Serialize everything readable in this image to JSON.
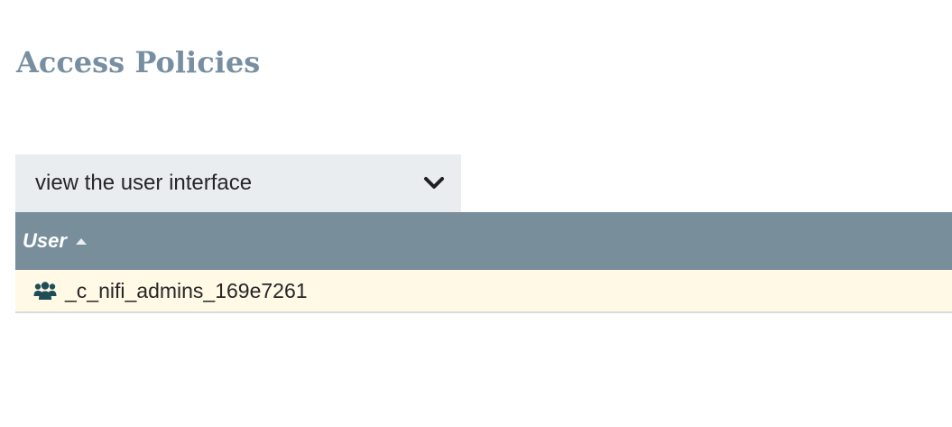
{
  "page": {
    "title": "Access Policies"
  },
  "policy_select": {
    "selected_value": "view the user interface",
    "icon": "chevron-down-icon"
  },
  "table": {
    "columns": [
      {
        "label": "User",
        "sort": "ascending"
      }
    ],
    "rows": [
      {
        "icon": "user-group-icon",
        "name": "_c_nifi_admins_169e7261"
      }
    ]
  },
  "colors": {
    "title": "#778fa0",
    "select_background": "#e9edf0",
    "header_background": "#798e9b",
    "row_background": "#fff9e6",
    "group_icon": "#1e4d55"
  }
}
